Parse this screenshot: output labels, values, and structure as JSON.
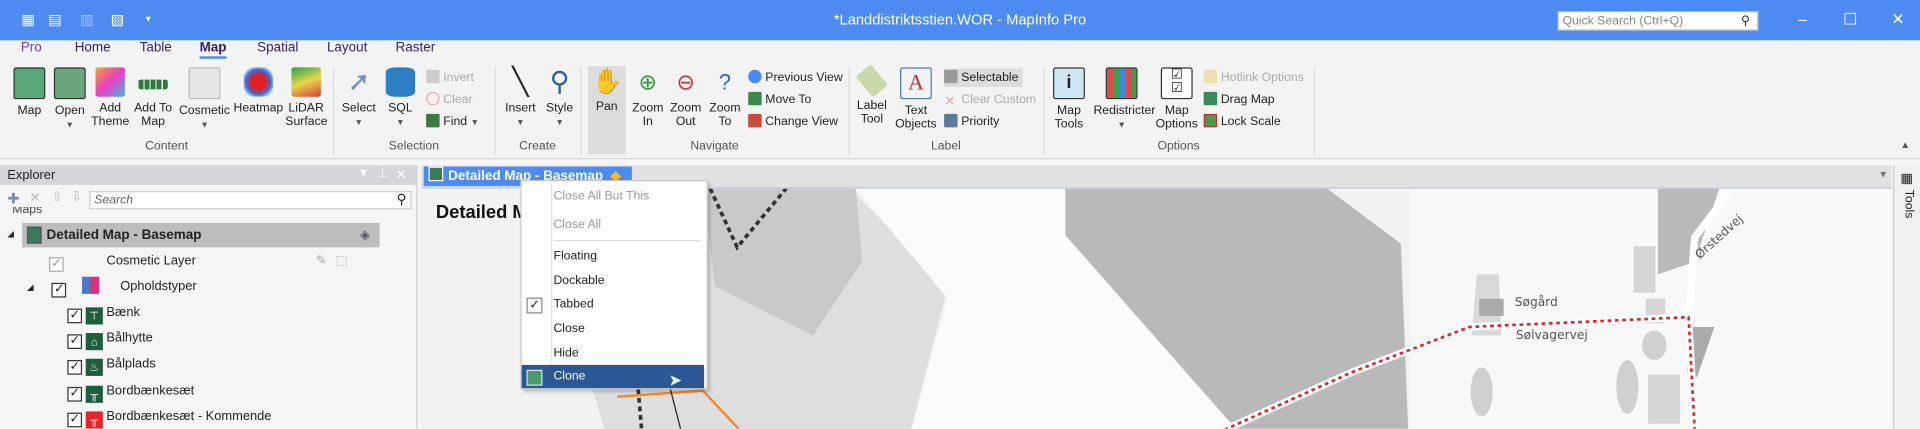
{
  "window": {
    "title": "*Landdistriktsstien.WOR - MapInfo Pro",
    "quick_search_placeholder": "Quick Search (Ctrl+Q)",
    "minimize": "–",
    "maximize": "☐",
    "close": "✕"
  },
  "ribbon_tabs": [
    "Pro",
    "Home",
    "Table",
    "Map",
    "Spatial",
    "Layout",
    "Raster"
  ],
  "ribbon": {
    "content": {
      "label": "Content",
      "map": "Map",
      "open": "Open",
      "add_theme": "Add Theme",
      "add_to_map": "Add To Map",
      "cosmetic": "Cosmetic",
      "heatmap": "Heatmap",
      "lidar": "LiDAR Surface"
    },
    "selection": {
      "label": "Selection",
      "select": "Select",
      "sql": "SQL",
      "invert": "Invert",
      "clear": "Clear",
      "find": "Find"
    },
    "create": {
      "label": "Create",
      "insert": "Insert",
      "style": "Style"
    },
    "navigate": {
      "label": "Navigate",
      "pan": "Pan",
      "zoom_in": "Zoom In",
      "zoom_out": "Zoom Out",
      "zoom_to": "Zoom To",
      "previous_view": "Previous View",
      "move_to": "Move To",
      "change_view": "Change View"
    },
    "label": {
      "label": "Label",
      "label_tool": "Label Tool",
      "text_objects": "Text Objects",
      "selectable": "Selectable",
      "clear_custom": "Clear Custom",
      "priority": "Priority"
    },
    "options": {
      "label": "Options",
      "map_tools": "Map Tools",
      "redistricter": "Redistricter",
      "map_options": "Map Options",
      "hotlink_options": "Hotlink Options",
      "drag_map": "Drag Map",
      "lock_scale": "Lock Scale"
    }
  },
  "explorer": {
    "title": "Explorer",
    "search_placeholder": "Search",
    "maps_label": "Maps",
    "map_name": "Detailed Map - Basemap",
    "cosmetic_layer": "Cosmetic Layer",
    "group": "Opholdstyper",
    "layers": [
      {
        "name": "Bænk",
        "color": "#1e5e3a"
      },
      {
        "name": "Bålhytte",
        "color": "#1e5e3a"
      },
      {
        "name": "Bålplads",
        "color": "#1e5e3a"
      },
      {
        "name": "Bordbænkesæt",
        "color": "#1e5e3a"
      },
      {
        "name": "Bordbænkesæt - Kommende",
        "color": "#e8232a"
      }
    ]
  },
  "document": {
    "tab_label": "Detailed Map - Basemap",
    "map_title": "Detailed M",
    "labels": {
      "place": "Søgård",
      "road1": "Sølvagervej",
      "road2": "Ørstedvej"
    }
  },
  "side_panel": {
    "tools": "Tools"
  },
  "context_menu": {
    "items": [
      {
        "label": "Close All But This",
        "disabled": true
      },
      {
        "label": "Close All",
        "disabled": true
      },
      {
        "label": "Floating"
      },
      {
        "label": "Dockable"
      },
      {
        "label": "Tabbed",
        "checked": true
      },
      {
        "label": "Close"
      },
      {
        "label": "Hide"
      },
      {
        "label": "Clone",
        "highlighted": true
      }
    ]
  },
  "colors": {
    "titlebar": "#4d8bf2",
    "highlight": "#2b5797",
    "route": "#e8232a"
  }
}
